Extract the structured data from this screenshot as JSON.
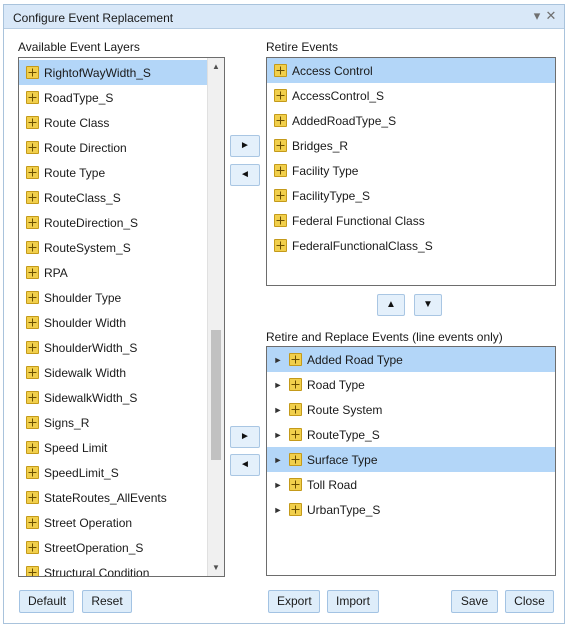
{
  "window": {
    "title": "Configure Event Replacement"
  },
  "icons": {
    "title_menu": "chevron-down-icon",
    "close": "close-icon",
    "layer": "feature-layer-icon"
  },
  "available": {
    "label": "Available Event Layers",
    "items": [
      "RightofWayWidth_S",
      "RoadType_S",
      "Route Class",
      "Route Direction",
      "Route Type",
      "RouteClass_S",
      "RouteDirection_S",
      "RouteSystem_S",
      "RPA",
      "Shoulder Type",
      "Shoulder Width",
      "ShoulderWidth_S",
      "Sidewalk Width",
      "SidewalkWidth_S",
      "Signs_R",
      "Speed Limit",
      "SpeedLimit_S",
      "StateRoutes_AllEvents",
      "Street Operation",
      "StreetOperation_S",
      "Structural Condition"
    ],
    "selected": "RightofWayWidth_S",
    "scroll_position": 0.72
  },
  "retire": {
    "label": "Retire Events",
    "items": [
      "Access Control",
      "AccessControl_S",
      "AddedRoadType_S",
      "Bridges_R",
      "Facility Type",
      "FacilityType_S",
      "Federal Functional Class",
      "FederalFunctionalClass_S"
    ],
    "selected": "Access Control"
  },
  "replace": {
    "label": "Retire and Replace Events (line events only)",
    "items": [
      "Added Road Type",
      "Road Type",
      "Route System",
      "RouteType_S",
      "Surface Type",
      "Toll Road",
      "UrbanType_S"
    ],
    "selected": [
      "Added Road Type",
      "Surface Type"
    ]
  },
  "buttons": {
    "move_right": "►",
    "move_left": "◄",
    "move_up": "▲",
    "move_down": "▼",
    "default": "Default",
    "reset": "Reset",
    "export": "Export",
    "import": "Import",
    "save": "Save",
    "close": "Close"
  },
  "colors": {
    "selection": "#b3d6f8",
    "titlebar": "#d9e8f8",
    "button": "#deedfa",
    "layer_icon": "#f1cf4b"
  }
}
